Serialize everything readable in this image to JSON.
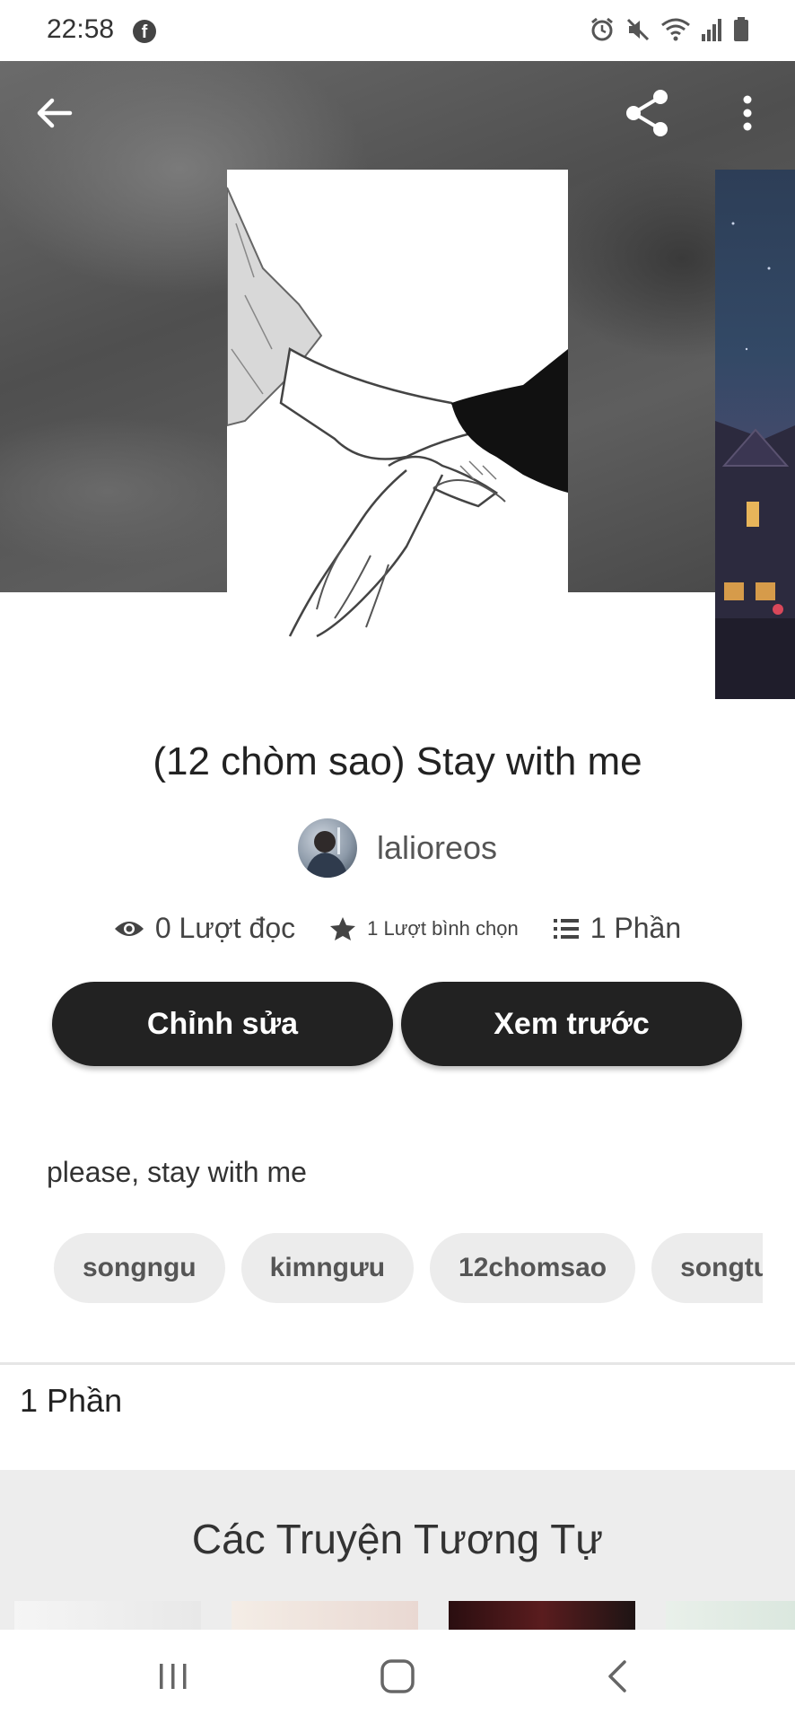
{
  "status_bar": {
    "time": "22:58",
    "icons": [
      "facebook-icon",
      "alarm-icon",
      "mute-icon",
      "wifi-icon",
      "signal-icon",
      "battery-icon"
    ]
  },
  "toolbar": {
    "icons": [
      "back-arrow-icon",
      "share-icon",
      "more-vertical-icon"
    ]
  },
  "story": {
    "title": "(12 chòm sao) Stay with me",
    "author": "lalioreos",
    "stats": {
      "reads": "0 Lượt đọc",
      "votes": "1 Lượt bình chọn",
      "parts": "1 Phần"
    },
    "description": "please, stay with me",
    "tags": [
      "songngu",
      "kimngưu",
      "12chomsao",
      "songtu"
    ]
  },
  "buttons": {
    "edit": "Chỉnh sửa",
    "preview": "Xem trước"
  },
  "parts_section": {
    "label": "1 Phần"
  },
  "similar_section": {
    "title": "Các Truyện Tương Tự"
  },
  "nav_bar": {
    "icons": [
      "recent-apps-icon",
      "home-icon",
      "back-icon"
    ]
  },
  "colors": {
    "button_bg": "#222222",
    "tag_bg": "#ececec",
    "hero_bg": "#5a5a5a",
    "similar_bg": "#ededed"
  }
}
